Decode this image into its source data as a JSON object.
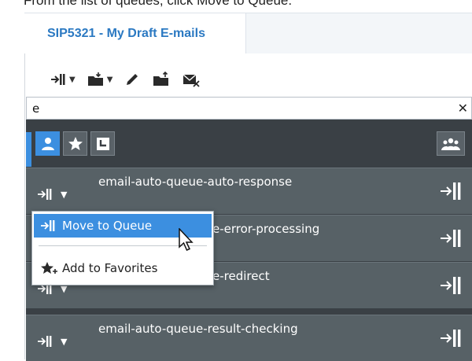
{
  "instruction": "From the list of queues, click Move to Queue.",
  "tab": {
    "title": "SIP5321 - My Draft E-mails"
  },
  "toolbar": {
    "buttons": [
      {
        "name": "move-to-queue-dropdown-icon",
        "has_caret": true
      },
      {
        "name": "move-to-folder-dropdown-icon",
        "has_caret": true
      },
      {
        "name": "edit-icon",
        "has_caret": false
      },
      {
        "name": "folder-upload-icon",
        "has_caret": false
      },
      {
        "name": "delete-email-icon",
        "has_caret": false
      }
    ]
  },
  "search": {
    "value": "e",
    "clear_label": "✕"
  },
  "results_tabs": [
    {
      "name": "agent-icon",
      "active": true
    },
    {
      "name": "favorites-star-icon",
      "active": false
    },
    {
      "name": "recent-icon",
      "active": false
    }
  ],
  "queue_rows": [
    {
      "label": "email-auto-queue-auto-response"
    },
    {
      "label": "e-error-processing"
    },
    {
      "label": "e-redirect"
    },
    {
      "label": "email-auto-queue-result-checking"
    }
  ],
  "context_menu": {
    "items": [
      {
        "label": "Move to Queue",
        "highlighted": true
      },
      {
        "label": "Add to Favorites",
        "highlighted": false
      }
    ]
  },
  "colors": {
    "accent": "#3c8fe0",
    "tab_title": "#2b79c2",
    "list_background": "#3a4045",
    "row_background": "#576166"
  }
}
